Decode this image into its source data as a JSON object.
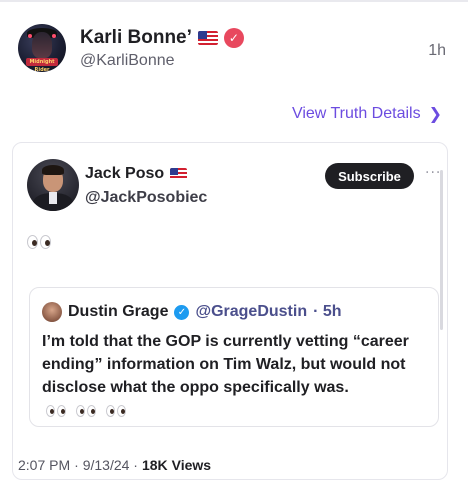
{
  "post": {
    "author_name": "Karli Bonne’",
    "author_handle": "@KarliBonne",
    "time_ago": "1h",
    "view_details_label": "View Truth Details",
    "verified_badge_glyph": "✓",
    "avatar_banner_text": "Midnight Rider",
    "icons": [
      "us-flag-icon",
      "verified-badge-icon",
      "chevron-right-icon"
    ]
  },
  "embedded": {
    "author_name": "Jack Poso",
    "author_handle": "@JackPosobiec",
    "subscribe_label": "Subscribe",
    "more_label": "···",
    "body_emoji": "👀",
    "quote": {
      "author_name": "Dustin Grage",
      "author_handle": "@GrageDustin",
      "time_ago": "· 5h",
      "text": "I’m told that the GOP is currently vetting “career ending” information on Tim Walz, but would not disclose what the oppo specifically was.",
      "trailing_emoji": "👀 👀 👀"
    },
    "meta": {
      "time": "2:07 PM",
      "date": "· 9/13/24 ·",
      "views_count": "18K",
      "views_label": "Views"
    }
  },
  "colors": {
    "accent": "#6c4ce0",
    "verified_red": "#e8485e",
    "verified_blue": "#1d9bf0",
    "subscribe_bg": "#1f1f23"
  }
}
